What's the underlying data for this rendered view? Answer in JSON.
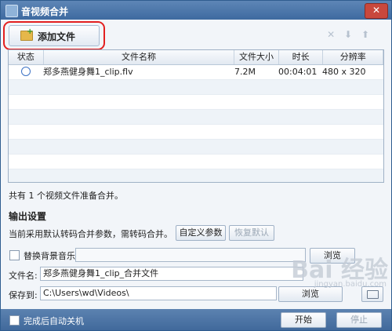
{
  "window": {
    "title": "音视频合并",
    "close_label": "✕"
  },
  "toolbar": {
    "add_file_label": "添加文件",
    "icons": [
      "✕",
      "⬇",
      "⬆"
    ]
  },
  "table": {
    "headers": [
      "状态",
      "文件名称",
      "文件大小",
      "时长",
      "分辨率"
    ],
    "rows": [
      {
        "name": "郑多燕健身舞1_clip.flv",
        "size": "7.2M",
        "duration": "00:04:01",
        "resolution": "480 x 320"
      }
    ]
  },
  "summary": "共有 1 个视频文件准备合并。",
  "output": {
    "heading": "输出设置",
    "desc": "当前采用默认转码合并参数，需转码合并。",
    "custom_params_label": "自定义参数",
    "restore_default_label": "恢复默认",
    "bg_music_label": "替换背景音乐",
    "browse_label": "浏览",
    "filename_label": "文件名:",
    "filename_value": "郑多燕健身舞1_clip_合并文件",
    "saveto_label": "保存到:",
    "saveto_value": "C:\\Users\\wd\\Videos\\",
    "saveto_browse_label": "浏览"
  },
  "footer": {
    "auto_shutdown_label": "完成后自动关机",
    "start_label": "开始",
    "stop_label": "停止"
  },
  "watermark": {
    "logo": "Bai 经验",
    "url": "jingyan.baidu.com"
  }
}
